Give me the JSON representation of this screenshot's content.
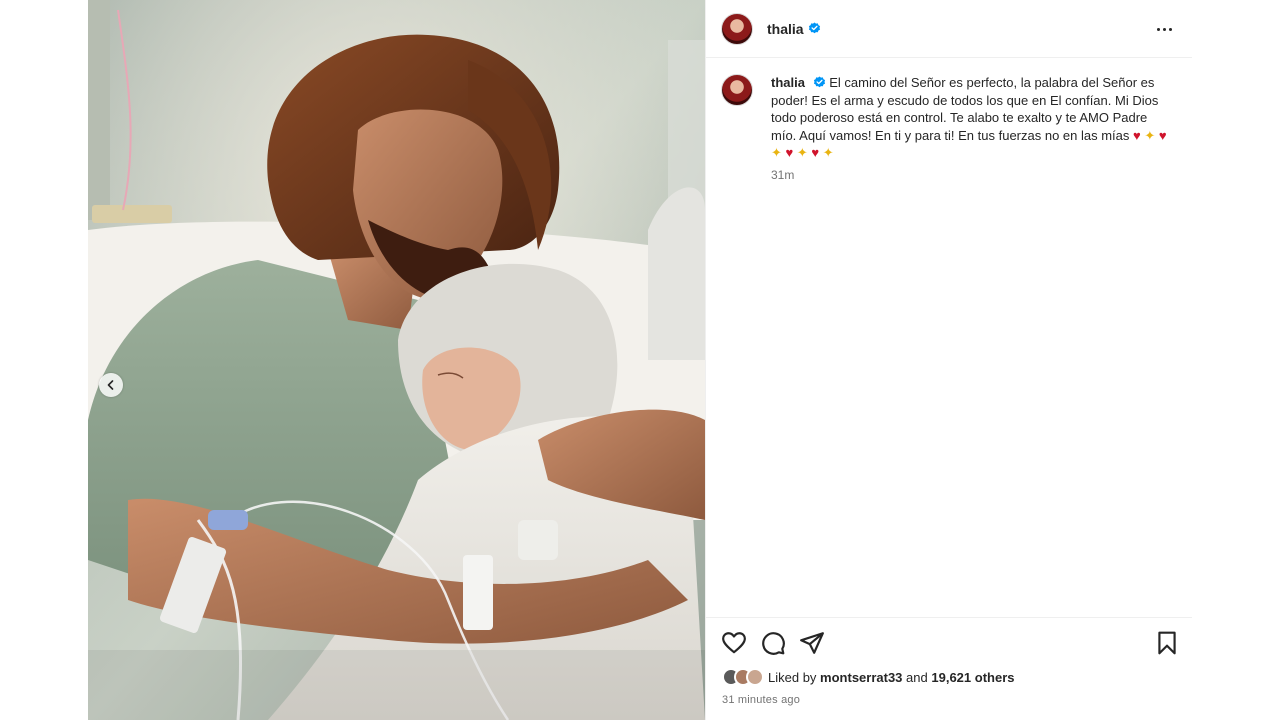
{
  "post": {
    "username": "thalia",
    "caption": "El camino del Señor es perfecto, la palabra del Señor es poder! Es el arma y escudo de todos los que en El confían. Mi Dios todo poderoso está en control. Te alabo te exalto y te AMO Padre mío. Aquí vamos! En ti y para ti! En tus fuerzas no en las mías",
    "caption_emojis": [
      "heart",
      "sparkles",
      "heart",
      "sparkles",
      "heart",
      "sparkles",
      "heart",
      "sparkles"
    ],
    "caption_time": "31m",
    "liked_by_label": "Liked by",
    "liked_by_user": "montserrat33",
    "and_label": "and",
    "others_count": "19,621 others",
    "post_time": "31 minutes ago"
  },
  "icons": {
    "verified": "verified-badge-icon",
    "more": "more-options-icon",
    "like": "heart-icon",
    "comment": "comment-icon",
    "share": "share-icon",
    "save": "bookmark-icon",
    "carousel_prev": "chevron-left-icon"
  },
  "colors": {
    "verified_blue": "#0095f6",
    "text_primary": "#262626",
    "text_secondary": "#737373",
    "divider": "#efefef"
  }
}
